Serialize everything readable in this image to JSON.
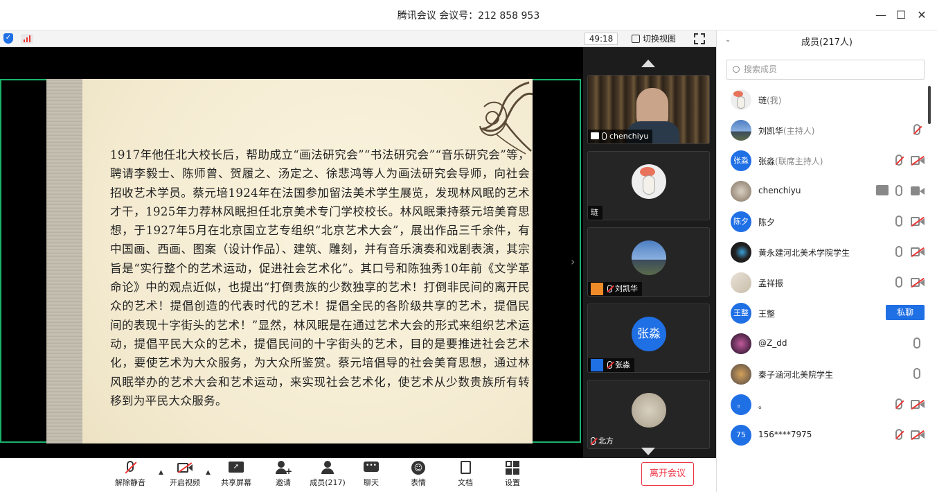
{
  "window": {
    "title": "腾讯会议  会议号：212 858 953",
    "minimize_glyph": "—",
    "maximize_glyph": "☐",
    "close_glyph": "✕"
  },
  "status": {
    "timer": "49:18",
    "switch_view": "切换视图"
  },
  "slide": {
    "text": "1917年他任北大校长后，帮助成立“画法研究会”“书法研究会”“音乐研究会”等，聘请李毅士、陈师曾、贺履之、汤定之、徐悲鸿等人为画法研究会导师，向社会招收艺术学员。蔡元培1924年在法国参加留法美术学生展览，发现林风眠的艺术才干，1925年力荐林风眠担任北京美术专门学校校长。林风眠秉持蔡元培美育思想，于1927年5月在北京国立艺专组织“北京艺术大会”，展出作品三千余件，有中国画、西画、图案（设计作品）、建筑、雕刻，并有音乐演奏和戏剧表演，其宗旨是“实行整个的艺术运动，促进社会艺术化”。其口号和陈独秀10年前《文学革命论》中的观点近似，也提出“打倒贵族的少数独享的艺术！打倒非民间的离开民众的艺术！提倡创造的代表时代的艺术！提倡全民的各阶级共享的艺术，提倡民间的表现十字街头的艺术！”显然，林风眠是在通过艺术大会的形式来组织艺术运动，提倡平民大众的艺术，提倡民间的十字街头的艺术，目的是要推进社会艺术化，要使艺术为大众服务，为大众所鉴赏。蔡元培倡导的社会美育思想，通过林风眠举办的艺术大会和艺术运动，来实现社会艺术化，使艺术从少数贵族所有转移到为平民大众服务。"
  },
  "video_tiles": [
    {
      "name": "chenchiyu",
      "avatar_text": ""
    },
    {
      "name": "琏",
      "avatar_text": ""
    },
    {
      "name": "刘凯华",
      "avatar_text": ""
    },
    {
      "name": "张淼",
      "avatar_text": "张淼"
    },
    {
      "name": "北方",
      "avatar_text": ""
    }
  ],
  "toolbar": {
    "unmute": "解除静音",
    "start_video": "开启视频",
    "share_screen": "共享屏幕",
    "invite": "邀请",
    "members": "成员(217)",
    "chat": "聊天",
    "reaction": "表情",
    "docs": "文档",
    "settings": "设置",
    "leave": "离开会议"
  },
  "panel": {
    "title": "成员(217人)",
    "search_placeholder": "搜索成员",
    "private_chat": "私聊",
    "members": [
      {
        "name": "琏",
        "role": "(我)",
        "avatar_text": ""
      },
      {
        "name": "刘凯华",
        "role": "(主持人)",
        "avatar_text": ""
      },
      {
        "name": "张淼",
        "role": "(联席主持人)",
        "avatar_text": "张淼"
      },
      {
        "name": "chenchiyu",
        "role": "",
        "avatar_text": ""
      },
      {
        "name": "陈夕",
        "role": "",
        "avatar_text": "陈夕"
      },
      {
        "name": "黄永建河北美术学院学生",
        "role": "",
        "avatar_text": ""
      },
      {
        "name": "孟祥振",
        "role": "",
        "avatar_text": ""
      },
      {
        "name": "王整",
        "role": "",
        "avatar_text": "王整"
      },
      {
        "name": "@Z_dd",
        "role": "",
        "avatar_text": ""
      },
      {
        "name": "秦子涵河北美院学生",
        "role": "",
        "avatar_text": ""
      },
      {
        "name": "。",
        "role": "",
        "avatar_text": "。"
      },
      {
        "name": "156****7975",
        "role": "",
        "avatar_text": "75"
      }
    ]
  },
  "colors": {
    "accent": "#1f6fe5",
    "frame_green": "#1ab36b",
    "leave_red": "#e33344",
    "slide_bg": "#f6eed7"
  }
}
